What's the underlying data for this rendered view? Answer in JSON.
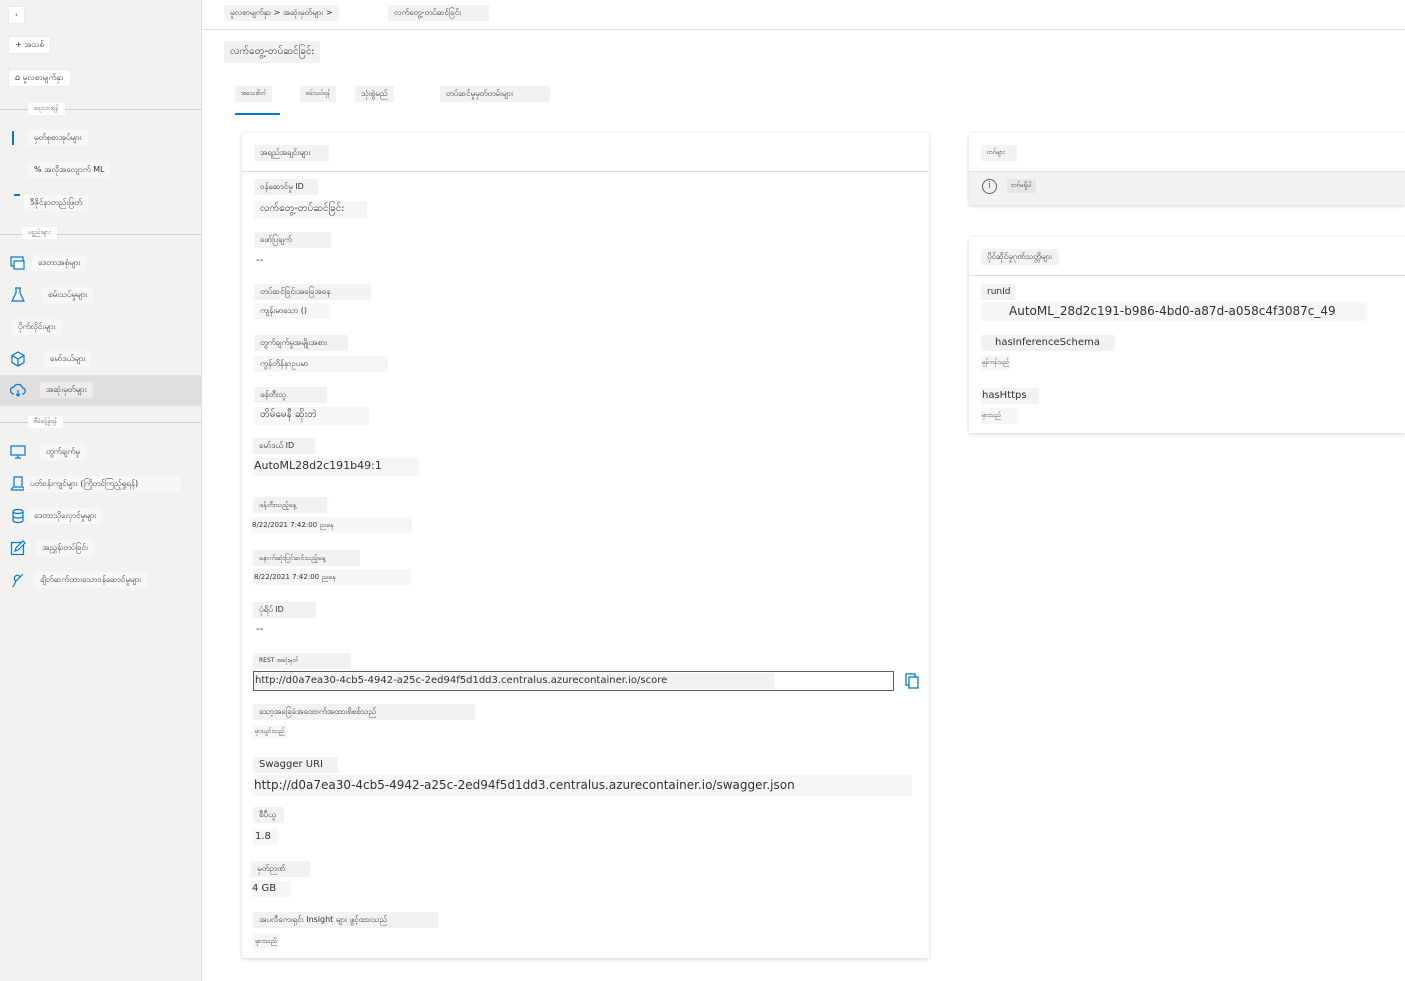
{
  "sidebar": {
    "collapse_label": "‹",
    "new_button": "+ အသစ်",
    "home_button": "⌂ မူလစာမျက်နှာ",
    "section_author": "ရေးသားရန်",
    "notebooks": "မှတ်စုစာအုပ်များ",
    "automl": "% အလိုအလျောက် ML",
    "designer": "ဒီဇိုင်နာတည်းဖြတ်",
    "section_assets": "ပစ္စည်းများ",
    "datasets": "ဒေတာအစုံများ",
    "experiments": "စမ်းသပ်မှုများ",
    "pipelines": "ပိုက်လိုင်းများ",
    "models": "မော်ဒယ်များ",
    "endpoints": "အဆုံးမှတ်များ",
    "section_manage": "စီမံခန့်ခွဲရန်",
    "compute": "တွက်ချက်မှု",
    "environments": "ပတ်ဝန်းကျင်များ (ကြိုတင်ကြည့်ရှုရန်)",
    "datastores": "ဒေတာသိုလှောင်မှုများ",
    "labeling": "အညွှန်းတပ်ခြင်း",
    "linked_services": "ချိတ်ဆက်ထားသောဝန်ဆောင်မှုများ"
  },
  "breadcrumb": {
    "path": "မူလစာမျက်နှာ > အဆုံးမှတ်များ >",
    "current": "လက်တွေ့-တပ်ဆင်ခြင်း"
  },
  "page_title": "လက်တွေ့-တပ်ဆင်ခြင်း",
  "tabs": [
    "အသေးစိတ်",
    "စမ်းသပ်ရန်",
    "သုံးစွဲမည်",
    "တပ်ဆင်မှုမှတ်တမ်းများ"
  ],
  "attributes": {
    "header": "အရည်အချင်းများ",
    "fields": {
      "service_id": {
        "label": "ဝန်ဆောင်မှု ID",
        "value": "လက်တွေ့-တပ်ဆင်ခြင်း"
      },
      "description": {
        "label": "ဖော်ပြချက်",
        "value": "--"
      },
      "deployment_state": {
        "label": "တပ်ဆင်ခြင်းအခြေအနေ",
        "value": "ကျန်းမာသော ()"
      },
      "compute_type": {
        "label": "တွက်ချက်မှုအမျိုးအစား",
        "value": "ကွန်တိန်နာဥပမာ"
      },
      "created_by": {
        "label": "ဖန်တီးသူ",
        "value": "တိမ်မေနီ ဆိုးတဲ"
      },
      "model_id": {
        "label": "မော်ဒယ် ID",
        "value": "AutoML28d2c191b49:1"
      },
      "created_on": {
        "label": "ဖန်တီးသည့်နေ့",
        "value": "8/22/2021 7:42:00 ညနေ"
      },
      "updated_on": {
        "label": "နောက်ဆုံးပြင်ဆင်သည့်နေ့",
        "value": "8/22/2021 7:42:00 ညနေ"
      },
      "image_id": {
        "label": "ပုံရိပ် ID",
        "value": "--"
      },
      "rest_endpoint": {
        "label": "REST အဆုံးမှတ်",
        "value": "http://d0a7ea30-4cb5-4942-a25c-2ed94f5d1dd3.centralus.azurecontainer.io/score"
      },
      "key_auth": {
        "label": "သော့အခြေခံအထောက်အထားစိစစ်သည်",
        "value": "မှားယွင်းသည်"
      },
      "swagger_uri": {
        "label": "Swagger URI",
        "value": "http://d0a7ea30-4cb5-4942-a25c-2ed94f5d1dd3.centralus.azurecontainer.io/swagger.json"
      },
      "cpu": {
        "label": "စီပီယူ",
        "value": "1.8"
      },
      "memory": {
        "label": "မှတ်ဉာဏ်",
        "value": "4 GB"
      },
      "app_insights": {
        "label": "အပလီကေးရှင်း Insight များ ဖွင့်ထားသည်",
        "value": "မှားသည်"
      }
    }
  },
  "tags": {
    "header": "တဂ်များ",
    "empty": "တဂ်မရှိပါ"
  },
  "properties": {
    "header": "ပိုင်ဆိုင်မှုဂုဏ်သတ္တိများ",
    "runId_label": "runId",
    "runId_value": "AutoML_28d2c191-b986-4bd0-a87d-a058c4f3087c_49",
    "hasInferenceSchema_label": "hasInferenceSchema",
    "hasInferenceSchema_value": "မှန်ကန်သည်",
    "hasHttps_label": "hasHttps",
    "hasHttps_value": "မှားသည်"
  },
  "colors": {
    "accent": "#0078d4",
    "sidebar_bg": "#f3f2f1",
    "active_item": "#e1dfdd"
  }
}
